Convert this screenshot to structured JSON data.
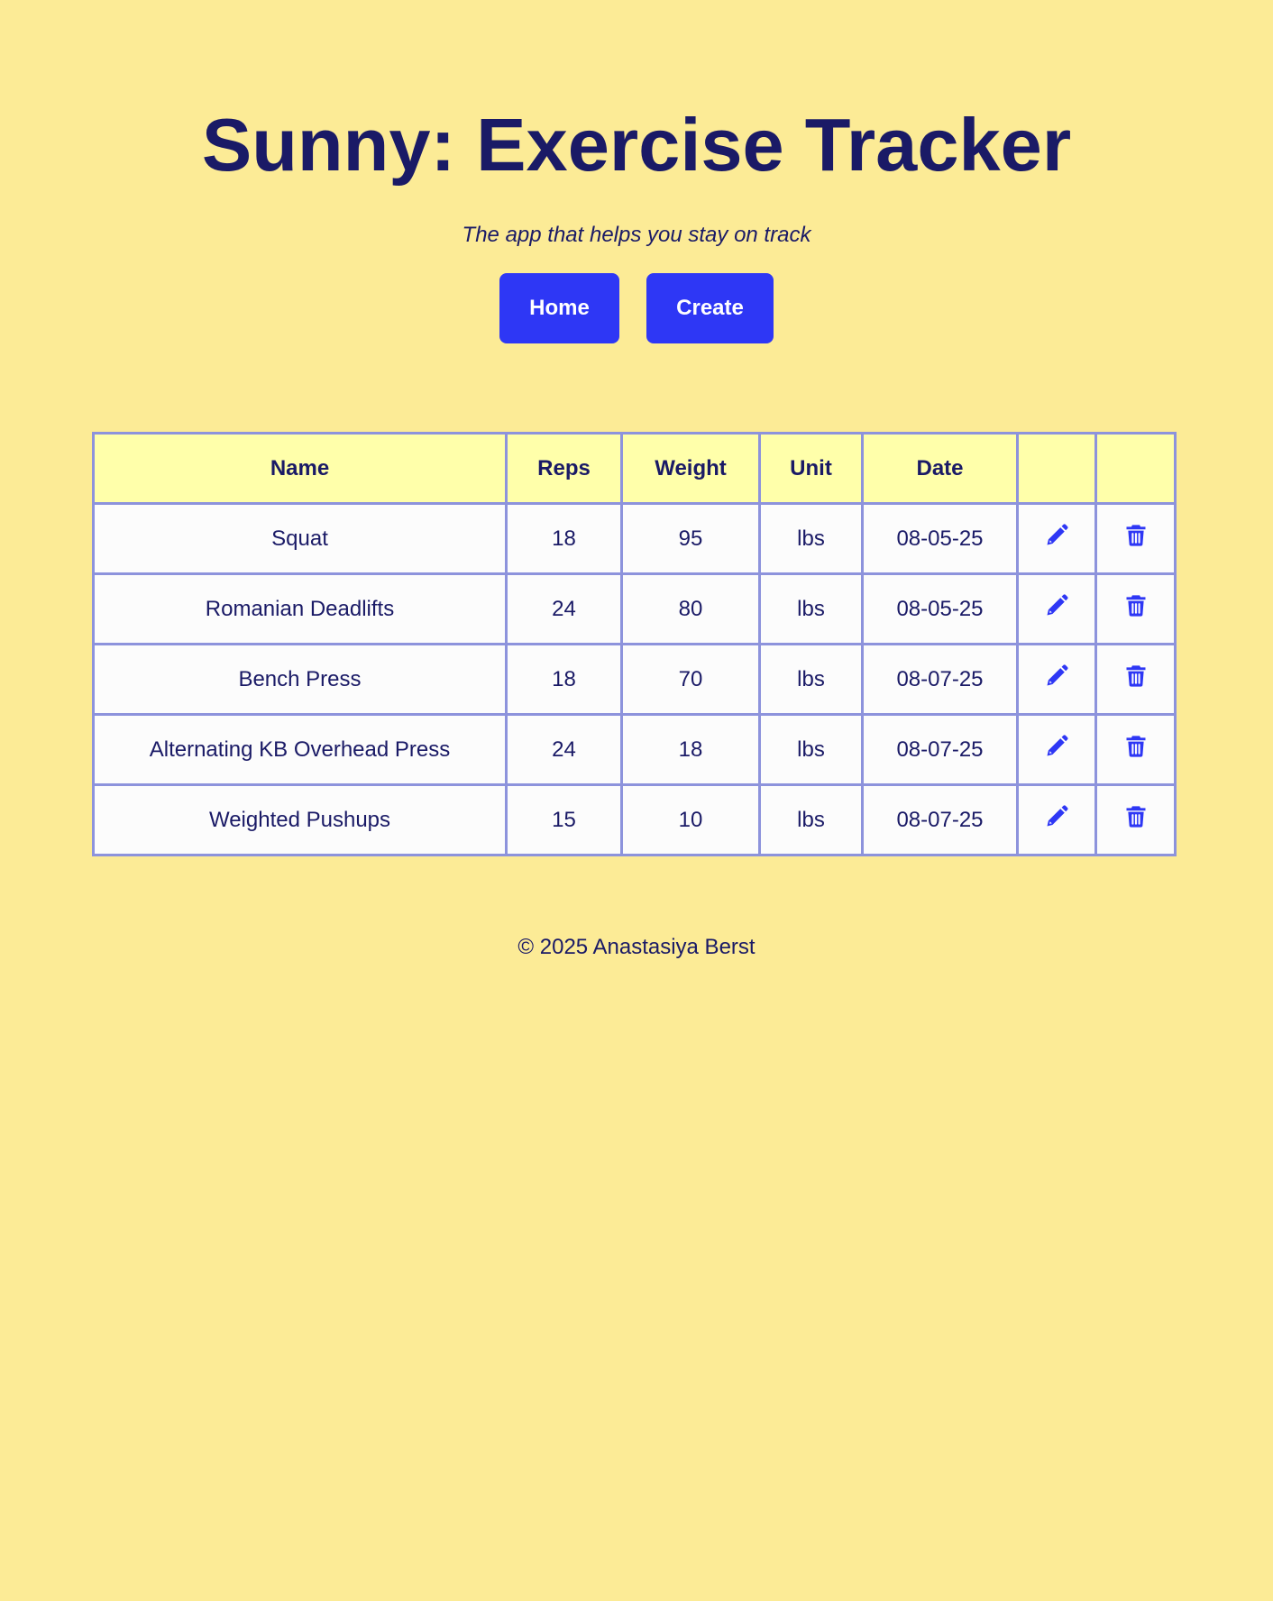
{
  "header": {
    "title": "Sunny: Exercise Tracker",
    "tagline": "The app that helps you stay on track"
  },
  "nav": {
    "home_label": "Home",
    "create_label": "Create"
  },
  "table": {
    "columns": [
      "Name",
      "Reps",
      "Weight",
      "Unit",
      "Date",
      "",
      ""
    ],
    "rows": [
      {
        "name": "Squat",
        "reps": "18",
        "weight": "95",
        "unit": "lbs",
        "date": "08-05-25"
      },
      {
        "name": "Romanian Deadlifts",
        "reps": "24",
        "weight": "80",
        "unit": "lbs",
        "date": "08-05-25"
      },
      {
        "name": "Bench Press",
        "reps": "18",
        "weight": "70",
        "unit": "lbs",
        "date": "08-07-25"
      },
      {
        "name": "Alternating KB Overhead Press",
        "reps": "24",
        "weight": "18",
        "unit": "lbs",
        "date": "08-07-25"
      },
      {
        "name": "Weighted Pushups",
        "reps": "15",
        "weight": "10",
        "unit": "lbs",
        "date": "08-07-25"
      }
    ],
    "row_actions": {
      "edit_icon": "pencil-icon",
      "delete_icon": "trash-icon"
    }
  },
  "footer": {
    "copyright": "© 2025 Anastasiya Berst"
  },
  "colors": {
    "background": "#fceb96",
    "text": "#1a1a66",
    "accent": "#2e37f5",
    "table_border": "#8d93dc",
    "header_row": "#ffffaa",
    "cell": "#fcfcfc"
  }
}
